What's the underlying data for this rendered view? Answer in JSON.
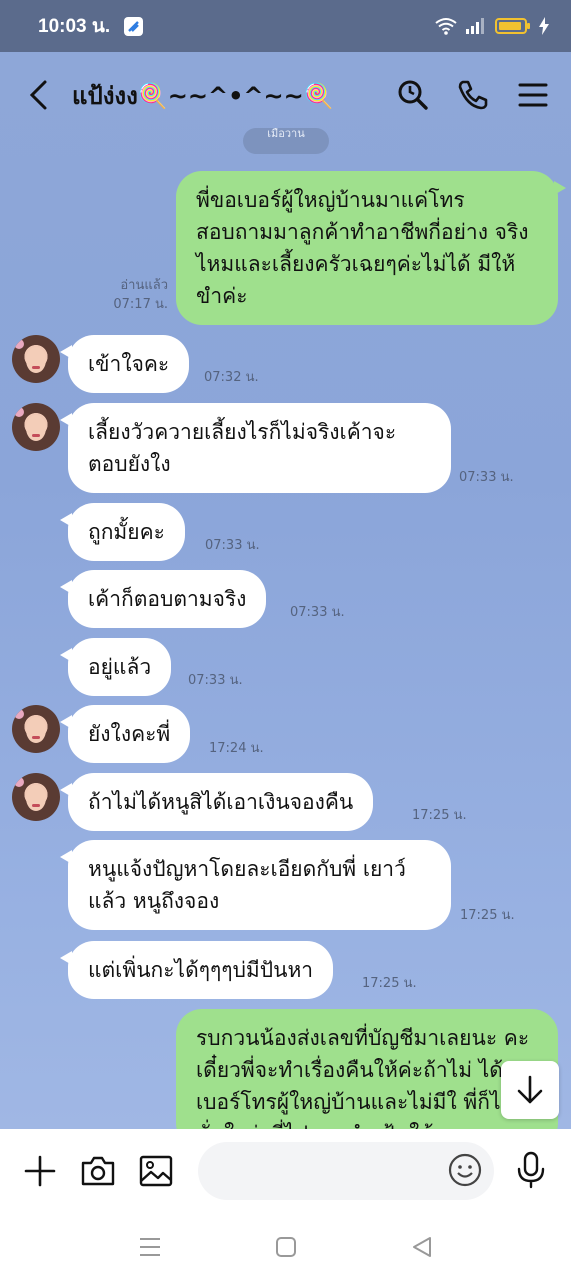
{
  "status_bar": {
    "time": "10:03 น."
  },
  "header": {
    "title": "แป้ง่งง🍭~~^•^~~🍭"
  },
  "date_pill": "เมื่อวาน",
  "messages": [
    {
      "side": "out",
      "text": "พี่ขอเบอร์ผู้ใหญ่บ้านมาแค่โทร สอบถามมาลูกค้าทำอาชีพกี่อย่าง จริงไหมและเลี้ยงครัวเฉยๆค่ะไม่ได้ มีให้ขำค่ะ",
      "read": "อ่านแล้ว",
      "time": "07:17 น."
    },
    {
      "side": "in",
      "text": "เข้าใจคะ",
      "time": "07:32 น."
    },
    {
      "side": "in",
      "text": "เลี้ยงวัวควายเลี้ยงไรก็ไม่จริงเค้าจะ ตอบยังใง",
      "time": "07:33 น."
    },
    {
      "side": "in",
      "text": "ถูกมั้ยคะ",
      "time": "07:33 น."
    },
    {
      "side": "in",
      "text": "เค้าก็ตอบตามจริง",
      "time": "07:33 น."
    },
    {
      "side": "in",
      "text": "อยู่แล้ว",
      "time": "07:33 น."
    },
    {
      "side": "in",
      "text": "ยังใงคะพี่",
      "time": "17:24 น."
    },
    {
      "side": "in",
      "text": "ถ้าไม่ได้หนูสิได้เอาเงินจองคืน",
      "time": "17:25 น."
    },
    {
      "side": "in",
      "text": "หนูแจ้งปัญหาโดยละเอียดกับพี่ เยาว์แล้ว หนูถึงจอง",
      "time": "17:25 น."
    },
    {
      "side": "in",
      "text": "แต่เพิ่นกะได้ๆๆๆบ่มีปันหา",
      "time": "17:25 น."
    },
    {
      "side": "out",
      "text": "รบกวนน้องส่งเลขที่บัญชีมาเลยนะ คะเดี๋ยวพี่จะทำเรื่องคืนให้ค่ะถ้าไม่ ได้เบอร์โทรผู้ใหญ่บ้านและไม่มีใ พี่ก็ไม่มั่นใจว่าพี่ไปแนะนำ ฟ้นให้"
    }
  ],
  "input": {
    "placeholder": ""
  },
  "colors": {
    "chat_bg": "#8ea7d8",
    "outgoing_bubble": "#9fe08d",
    "incoming_bubble": "#ffffff",
    "status_bar": "#5b6b8c"
  }
}
